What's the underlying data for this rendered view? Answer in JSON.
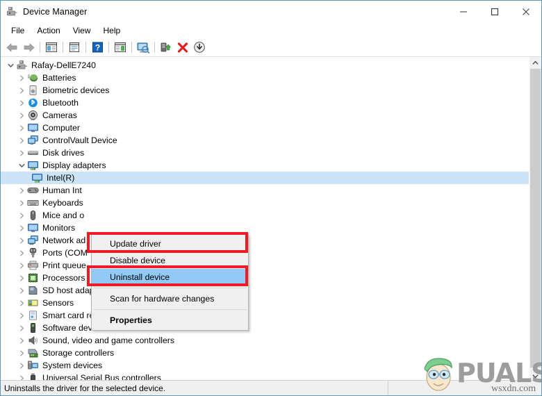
{
  "window": {
    "title": "Device Manager",
    "icon": "device-manager-icon",
    "controls": {
      "minimize": "minimize-icon",
      "maximize": "maximize-icon",
      "close": "close-icon"
    }
  },
  "menubar": {
    "items": [
      {
        "label": "File"
      },
      {
        "label": "Action"
      },
      {
        "label": "View"
      },
      {
        "label": "Help"
      }
    ]
  },
  "toolbar": {
    "buttons": [
      {
        "name": "back-icon"
      },
      {
        "name": "forward-icon"
      },
      {
        "name": "separator"
      },
      {
        "name": "show-hide-console-tree-icon"
      },
      {
        "name": "separator"
      },
      {
        "name": "properties-icon"
      },
      {
        "name": "separator"
      },
      {
        "name": "help-icon"
      },
      {
        "name": "separator"
      },
      {
        "name": "show-hide-action-pane-icon"
      },
      {
        "name": "separator"
      },
      {
        "name": "scan-for-hardware-changes-icon"
      },
      {
        "name": "separator"
      },
      {
        "name": "update-driver-icon"
      },
      {
        "name": "uninstall-device-icon"
      },
      {
        "name": "disable-device-icon"
      }
    ]
  },
  "tree": {
    "nodes": [
      {
        "label": "Rafay-DellE7240",
        "level": 0,
        "expanded": true,
        "icon": "computer-root-icon",
        "selected": false
      },
      {
        "label": "Batteries",
        "level": 1,
        "expanded": false,
        "icon": "battery-icon",
        "selected": false
      },
      {
        "label": "Biometric devices",
        "level": 1,
        "expanded": false,
        "icon": "fingerprint-icon",
        "selected": false
      },
      {
        "label": "Bluetooth",
        "level": 1,
        "expanded": false,
        "icon": "bluetooth-icon",
        "selected": false
      },
      {
        "label": "Cameras",
        "level": 1,
        "expanded": false,
        "icon": "camera-icon",
        "selected": false
      },
      {
        "label": "Computer",
        "level": 1,
        "expanded": false,
        "icon": "monitor-icon",
        "selected": false
      },
      {
        "label": "ControlVault Device",
        "level": 1,
        "expanded": false,
        "icon": "dual-monitor-icon",
        "selected": false
      },
      {
        "label": "Disk drives",
        "level": 1,
        "expanded": false,
        "icon": "disk-drive-icon",
        "selected": false
      },
      {
        "label": "Display adapters",
        "level": 1,
        "expanded": true,
        "icon": "display-adapter-icon",
        "selected": false
      },
      {
        "label": "Intel(R)",
        "level": 2,
        "expanded": null,
        "icon": "display-adapter-icon",
        "selected": true
      },
      {
        "label": "Human Int",
        "level": 1,
        "expanded": false,
        "icon": "hid-icon",
        "selected": false
      },
      {
        "label": "Keyboards",
        "level": 1,
        "expanded": false,
        "icon": "keyboard-icon",
        "selected": false
      },
      {
        "label": "Mice and o",
        "level": 1,
        "expanded": false,
        "icon": "mouse-icon",
        "selected": false
      },
      {
        "label": "Monitors",
        "level": 1,
        "expanded": false,
        "icon": "monitor-icon",
        "selected": false
      },
      {
        "label": "Network ad",
        "level": 1,
        "expanded": false,
        "icon": "network-adapter-icon",
        "selected": false
      },
      {
        "label": "Ports (COM",
        "level": 1,
        "expanded": false,
        "icon": "port-icon",
        "selected": false
      },
      {
        "label": "Print queue",
        "level": 1,
        "expanded": false,
        "icon": "printer-icon",
        "selected": false
      },
      {
        "label": "Processors",
        "level": 1,
        "expanded": false,
        "icon": "processor-icon",
        "selected": false
      },
      {
        "label": "SD host adapters",
        "level": 1,
        "expanded": false,
        "icon": "sd-host-icon",
        "selected": false
      },
      {
        "label": "Sensors",
        "level": 1,
        "expanded": false,
        "icon": "sensor-icon",
        "selected": false
      },
      {
        "label": "Smart card readers",
        "level": 1,
        "expanded": false,
        "icon": "smartcard-icon",
        "selected": false
      },
      {
        "label": "Software devices",
        "level": 1,
        "expanded": false,
        "icon": "software-device-icon",
        "selected": false
      },
      {
        "label": "Sound, video and game controllers",
        "level": 1,
        "expanded": false,
        "icon": "speaker-icon",
        "selected": false
      },
      {
        "label": "Storage controllers",
        "level": 1,
        "expanded": false,
        "icon": "storage-controller-icon",
        "selected": false
      },
      {
        "label": "System devices",
        "level": 1,
        "expanded": false,
        "icon": "system-device-icon",
        "selected": false
      },
      {
        "label": "Universal Serial Bus controllers",
        "level": 1,
        "expanded": false,
        "icon": "usb-icon",
        "selected": false
      }
    ]
  },
  "context_menu": {
    "items": [
      {
        "label": "Update driver",
        "highlighted": false,
        "bold": false,
        "separator_after": false
      },
      {
        "label": "Disable device",
        "highlighted": false,
        "bold": false,
        "separator_after": false
      },
      {
        "label": "Uninstall device",
        "highlighted": true,
        "bold": false,
        "separator_after": true
      },
      {
        "label": "Scan for hardware changes",
        "highlighted": false,
        "bold": false,
        "separator_after": true
      },
      {
        "label": "Properties",
        "highlighted": false,
        "bold": true,
        "separator_after": false
      }
    ]
  },
  "annotations": {
    "color": "#ee1b24",
    "boxes": [
      {
        "target": "Update driver"
      },
      {
        "target": "Uninstall device"
      }
    ]
  },
  "statusbar": {
    "text": "Uninstalls the driver for the selected device."
  },
  "watermark": {
    "brand": "PUALS",
    "domain": "wsxdn.com"
  }
}
